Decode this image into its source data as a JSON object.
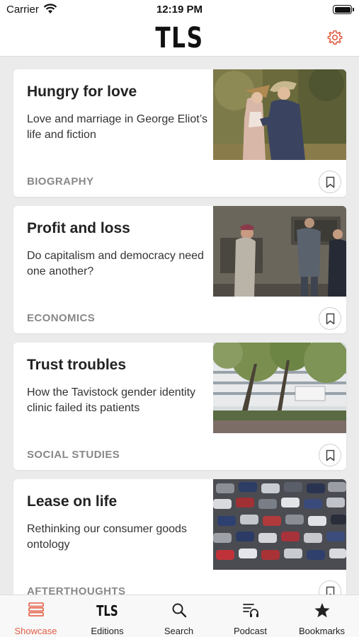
{
  "status_bar": {
    "carrier": "Carrier",
    "time": "12:19 PM"
  },
  "header": {
    "logo": "TLS",
    "settings_icon": "gear-icon"
  },
  "colors": {
    "accent": "#e25d43",
    "category": "#888888",
    "card_bg": "#ffffff",
    "page_bg": "#ebebeb"
  },
  "articles": [
    {
      "title": "Hungry for love",
      "description": "Love and marriage in George Eliot’s life and fiction",
      "category": "BIOGRAPHY",
      "image": "painting of a couple embracing"
    },
    {
      "title": "Profit and loss",
      "description": "Do capitalism and democracy need one another?",
      "category": "ECONOMICS",
      "image": "people at cash machines"
    },
    {
      "title": "Trust troubles",
      "description": "How the Tavistock gender identity clinic failed its patients",
      "category": "SOCIAL STUDIES",
      "image": "Tavistock Centre building among trees"
    },
    {
      "title": "Lease on life",
      "description": "Rethinking our consumer goods ontology",
      "category": "AFTERTHOUGHTS",
      "image": "rows of parked cars"
    }
  ],
  "tabs": [
    {
      "label": "Showcase",
      "icon": "showcase-icon",
      "active": true
    },
    {
      "label": "Editions",
      "icon": "tls-editions-icon",
      "active": false
    },
    {
      "label": "Search",
      "icon": "search-icon",
      "active": false
    },
    {
      "label": "Podcast",
      "icon": "podcast-icon",
      "active": false
    },
    {
      "label": "Bookmarks",
      "icon": "star-icon",
      "active": false
    }
  ]
}
